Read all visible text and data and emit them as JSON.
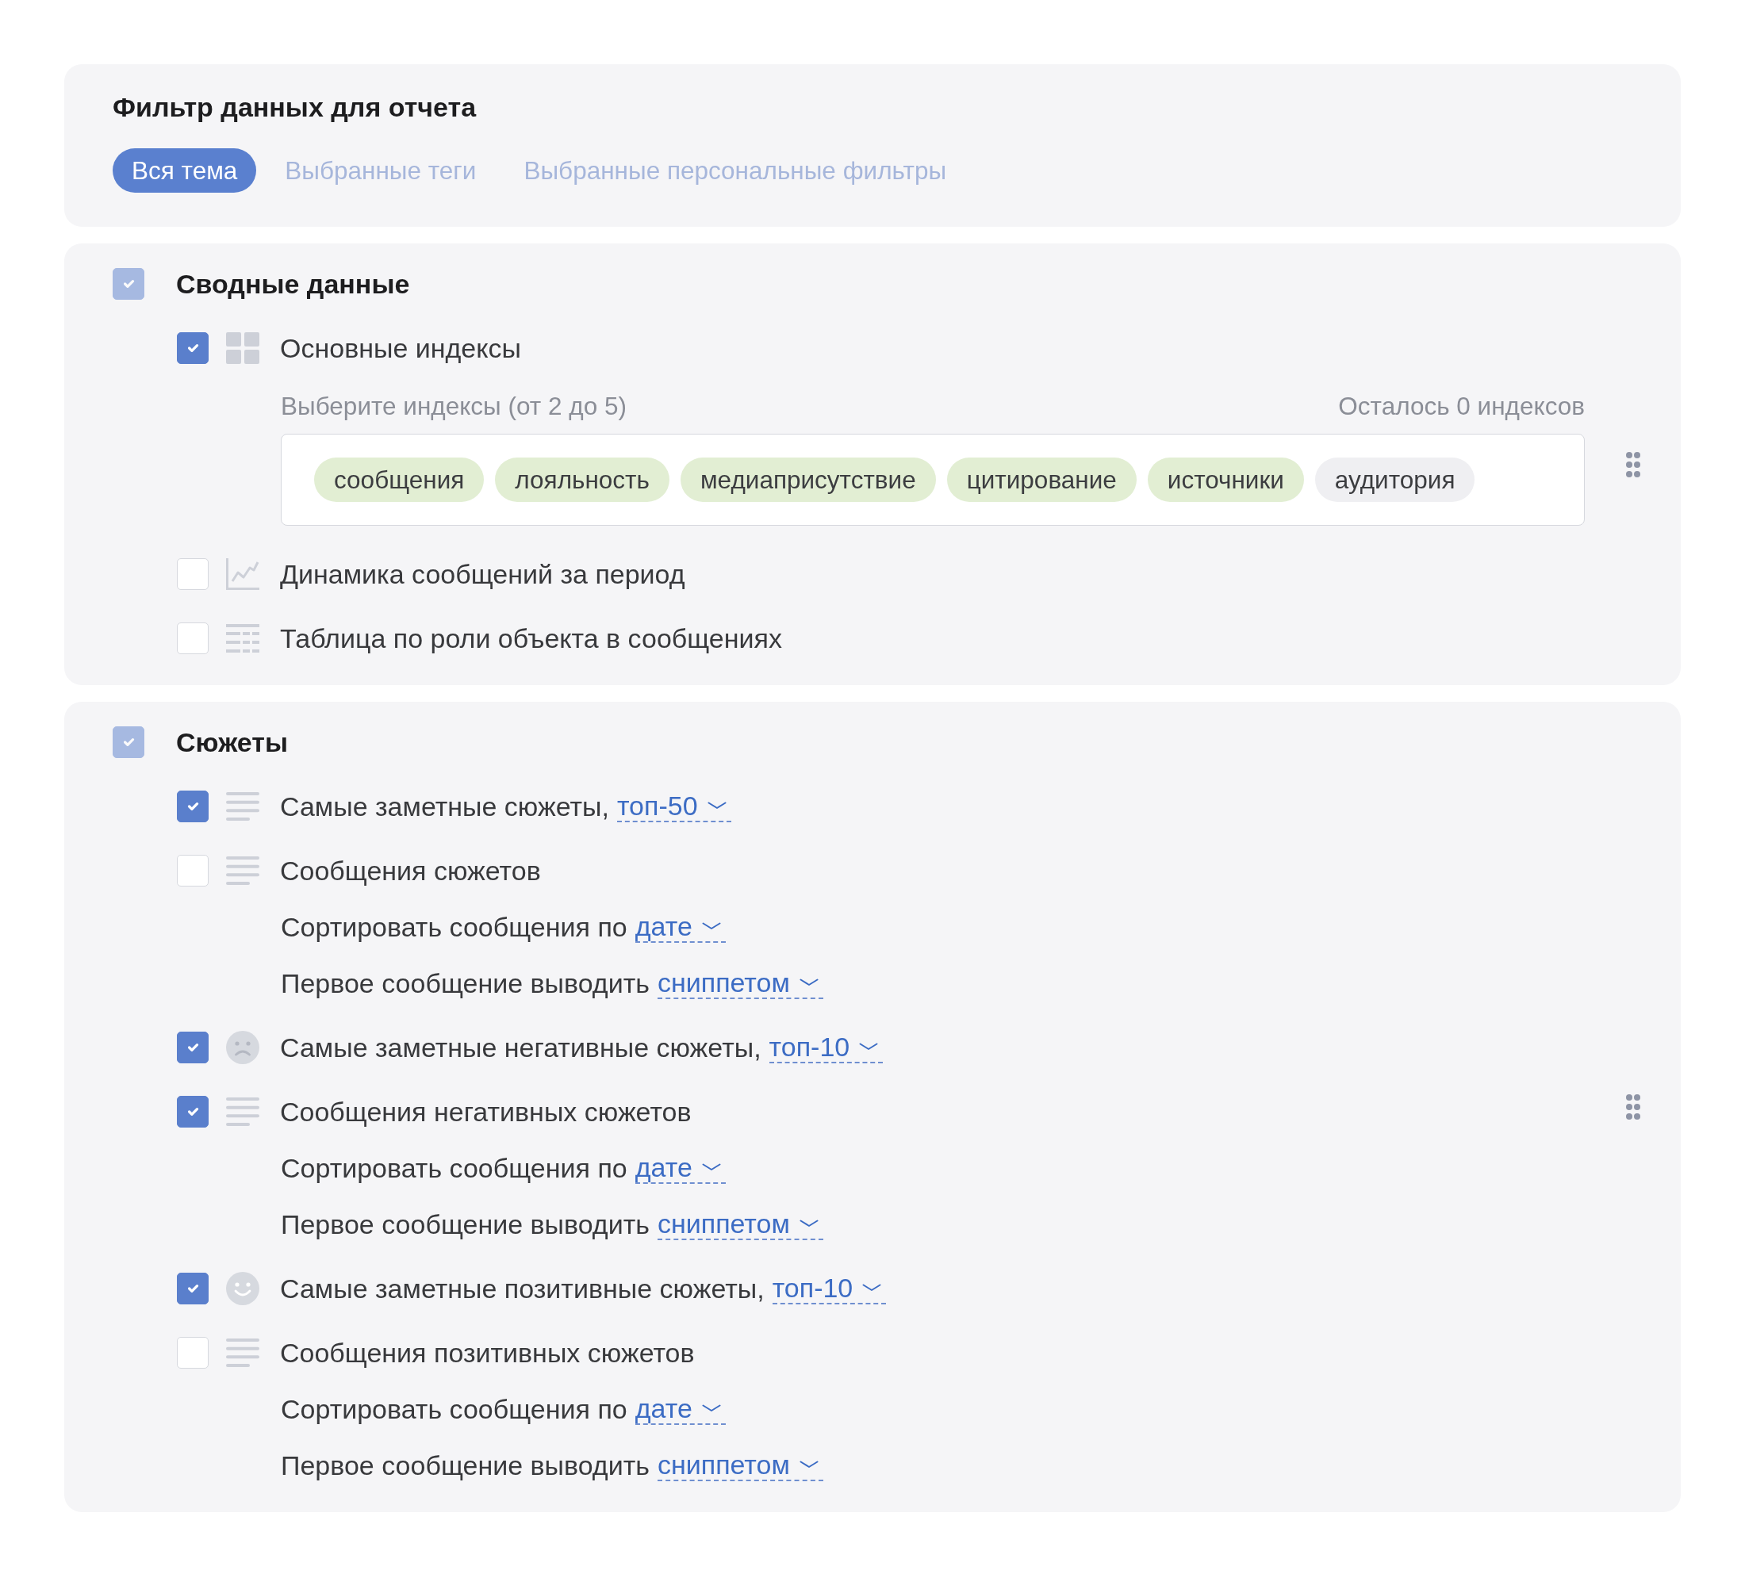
{
  "report_filter": {
    "title": "Фильтр данных для отчета",
    "tabs": [
      {
        "label": "Вся тема",
        "selected": true
      },
      {
        "label": "Выбранные теги",
        "selected": false
      },
      {
        "label": "Выбранные персональные фильтры",
        "selected": false
      }
    ]
  },
  "sections": [
    {
      "title": "Сводные данные",
      "checked": true,
      "disabled": true,
      "items": [
        {
          "kind": "grid",
          "label": "Основные индексы",
          "checked": true,
          "index_picker": {
            "hint": "Выберите индексы (от 2 до 5)",
            "remaining": "Осталось 0 индексов",
            "tags": [
              {
                "label": "сообщения",
                "selected": true
              },
              {
                "label": "лояльность",
                "selected": true
              },
              {
                "label": "медиаприсутствие",
                "selected": true
              },
              {
                "label": "цитирование",
                "selected": true
              },
              {
                "label": "источники",
                "selected": true
              },
              {
                "label": "аудитория",
                "selected": false
              }
            ]
          }
        },
        {
          "kind": "chart",
          "label": "Динамика сообщений за период",
          "checked": false
        },
        {
          "kind": "table",
          "label": "Таблица по роли объекта в сообщениях",
          "checked": false
        }
      ]
    },
    {
      "title": "Сюжеты",
      "checked": true,
      "disabled": true,
      "items": [
        {
          "kind": "list",
          "label": "Самые заметные сюжеты,",
          "dropdown": "топ-50",
          "checked": true
        },
        {
          "kind": "list",
          "label": "Сообщения сюжетов",
          "checked": false,
          "settings": [
            {
              "label": "Сортировать сообщения по",
              "dropdown": "дате"
            },
            {
              "label": "Первое сообщение выводить",
              "dropdown": "сниппетом"
            }
          ]
        },
        {
          "kind": "negative",
          "label": "Самые заметные негативные сюжеты,",
          "dropdown": "топ-10",
          "checked": true
        },
        {
          "kind": "list",
          "label": "Сообщения негативных сюжетов",
          "checked": true,
          "settings": [
            {
              "label": "Сортировать сообщения по",
              "dropdown": "дате"
            },
            {
              "label": "Первое сообщение выводить",
              "dropdown": "сниппетом"
            }
          ]
        },
        {
          "kind": "positive",
          "label": "Самые заметные позитивные сюжеты,",
          "dropdown": "топ-10",
          "checked": true
        },
        {
          "kind": "list",
          "label": "Сообщения позитивных сюжетов",
          "checked": false,
          "settings": [
            {
              "label": "Сортировать сообщения по",
              "dropdown": "дате"
            },
            {
              "label": "Первое сообщение выводить",
              "dropdown": "сниппетом"
            }
          ]
        }
      ]
    }
  ]
}
